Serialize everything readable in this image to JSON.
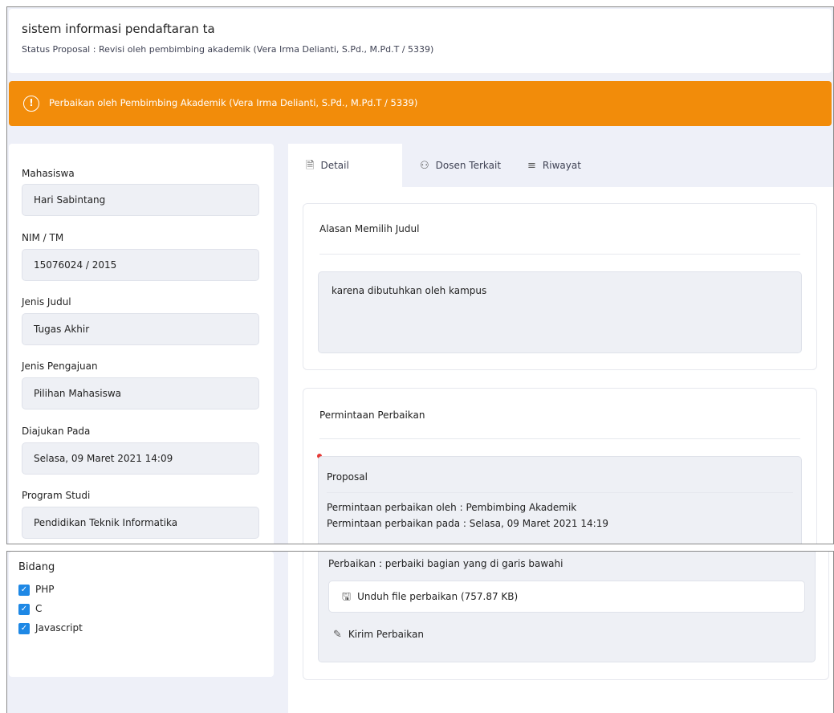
{
  "header": {
    "title": "sistem informasi pendaftaran ta",
    "status": "Status Proposal : Revisi oleh pembimbing akademik (Vera Irma Delianti, S.Pd., M.Pd.T / 5339)"
  },
  "alert": {
    "icon": "!",
    "text": "Perbaikan oleh Pembimbing Akademik (Vera Irma Delianti, S.Pd., M.Pd.T / 5339)",
    "color": "#f28c0a"
  },
  "student": {
    "fields": [
      {
        "label": "Mahasiswa",
        "value": "Hari Sabintang"
      },
      {
        "label": "NIM / TM",
        "value": "15076024 / 2015"
      },
      {
        "label": "Jenis Judul",
        "value": "Tugas Akhir"
      },
      {
        "label": "Jenis Pengajuan",
        "value": "Pilihan Mahasiswa"
      },
      {
        "label": "Diajukan Pada",
        "value": "Selasa, 09 Maret 2021 14:09"
      },
      {
        "label": "Program Studi",
        "value": "Pendidikan Teknik Informatika"
      }
    ],
    "bidang_label": "Bidang",
    "bidang": [
      "PHP",
      "C",
      "Javascript"
    ]
  },
  "tabs": [
    {
      "label": "Detail",
      "icon": "document-icon",
      "active": true
    },
    {
      "label": "Dosen Terkait",
      "icon": "users-icon",
      "active": false
    },
    {
      "label": "Riwayat",
      "icon": "list-icon",
      "active": false
    }
  ],
  "reason": {
    "title": "Alasan Memilih Judul",
    "text": "karena dibutuhkan oleh kampus"
  },
  "revision": {
    "title": "Permintaan Perbaikan",
    "item_title": "Proposal",
    "requested_by": "Permintaan perbaikan oleh : Pembimbing Akademik",
    "requested_at": "Permintaan perbaikan pada : Selasa, 09 Maret 2021 14:19",
    "note": "Perbaikan : perbaiki bagian yang di garis bawahi",
    "download_label": "Unduh file perbaikan (757.87 KB)",
    "send_label": "Kirim Perbaikan"
  }
}
